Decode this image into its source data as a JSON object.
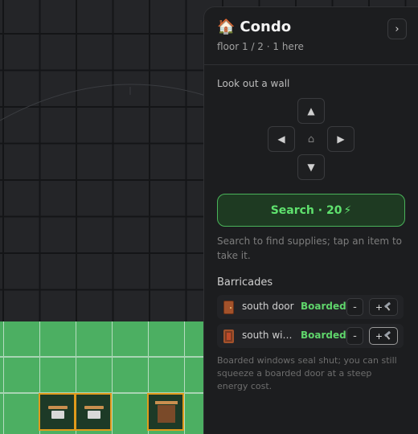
{
  "panel": {
    "title_icon": "🏠",
    "title": "Condo",
    "subtitle": "floor 1 / 2 · 1 here",
    "collapse_icon": "›"
  },
  "look": {
    "label": "Look out a wall",
    "up": "▲",
    "left": "◀",
    "center": "⌂",
    "right": "▶",
    "down": "▼"
  },
  "search": {
    "label": "Search · 20",
    "energy_icon": "⚡",
    "help": "Search to find supplies; tap an item to take it."
  },
  "barricades": {
    "label": "Barricades",
    "items": [
      {
        "name": "south door",
        "status": "Boarded",
        "minus": "-",
        "plus": "+",
        "icon": "door-icon"
      },
      {
        "name": "south window",
        "status": "Boarded",
        "minus": "-",
        "plus": "+",
        "icon": "window-icon"
      }
    ],
    "help": "Boarded windows seal shut; you can still squeeze a boarded door at a steep energy cost."
  },
  "colors": {
    "accent_green": "#5fe26e",
    "grass": "#4caf62",
    "highlight_orange": "#e09a1c"
  }
}
